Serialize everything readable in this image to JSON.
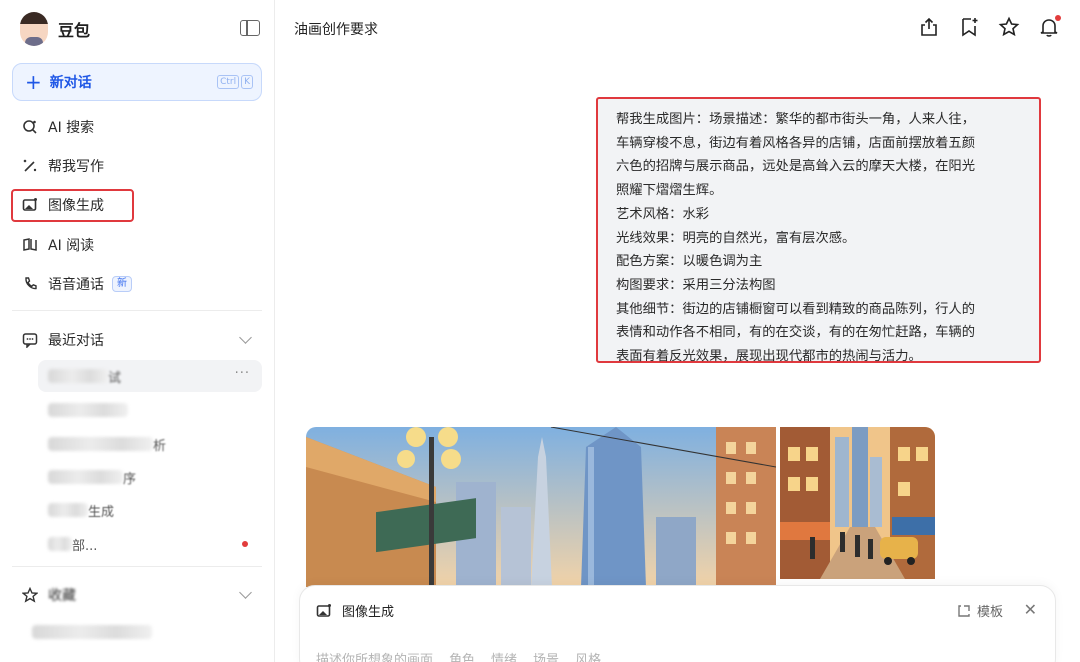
{
  "sidebar": {
    "brand_name": "豆包",
    "new_chat": {
      "label": "新对话",
      "shortcut_keys": [
        "Ctrl",
        "K"
      ]
    },
    "nav": [
      {
        "label": "AI 搜索",
        "icon": "ai-search-icon"
      },
      {
        "label": "帮我写作",
        "icon": "writing-icon"
      },
      {
        "label": "图像生成",
        "icon": "image-gen-icon",
        "highlighted": true
      },
      {
        "label": "AI 阅读",
        "icon": "reading-icon"
      },
      {
        "label": "语音通话",
        "icon": "phone-icon",
        "badge": "新"
      }
    ],
    "recent": {
      "title": "最近对话",
      "items": [
        {
          "text": "",
          "suffix": "试",
          "active": true,
          "more": "···"
        },
        {
          "text": "",
          "suffix": ""
        },
        {
          "text": "",
          "suffix": "析"
        },
        {
          "text": "",
          "suffix": "序"
        },
        {
          "text": "",
          "suffix": "生成"
        },
        {
          "text": "",
          "suffix": "部...",
          "dot": true
        }
      ]
    },
    "favorites": {
      "title": "收藏"
    }
  },
  "main": {
    "title": "油画创作要求",
    "user_message": [
      "帮我生成图片：场景描述：繁华的都市街头一角，人来人往，",
      "车辆穿梭不息，街边有着风格各异的店铺，店面前摆放着五颜",
      "六色的招牌与展示商品，远处是高耸入云的摩天大楼，在阳光",
      "照耀下熠熠生辉。",
      "艺术风格：水彩",
      "光线效果：明亮的自然光，富有层次感。",
      "配色方案：以暖色调为主",
      "构图要求：采用三分法构图",
      "其他细节：街边的店铺橱窗可以看到精致的商品陈列，行人的",
      "表情和动作各不相同，有的在交谈，有的在匆忙赶路，车辆的",
      "表面有着反光效果，展现出现代都市的热闹与活力。"
    ]
  },
  "composer": {
    "mode_label": "图像生成",
    "template_label": "模板",
    "placeholder_parts": [
      "描述你所想象的画面",
      "角色",
      "情绪",
      "场景",
      "风格"
    ]
  },
  "colors": {
    "accent": "#1f57e6",
    "highlight_border": "#e0393e",
    "bubble_bg": "#f2f3f5"
  }
}
